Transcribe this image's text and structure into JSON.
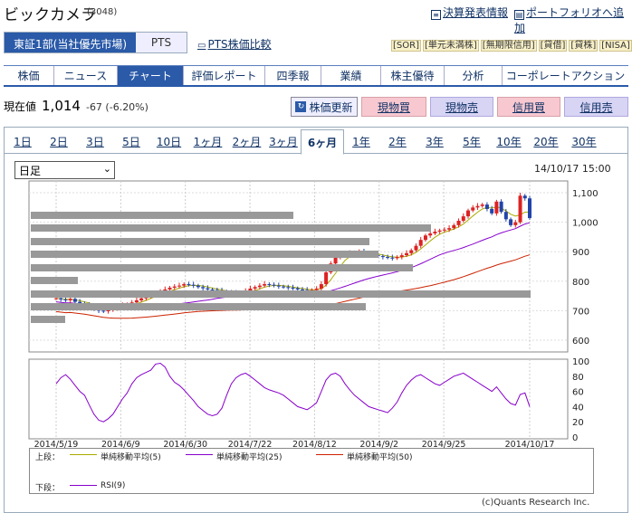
{
  "header": {
    "title": "ビックカメラ",
    "code": "(3048)",
    "links": [
      {
        "icon": "document-icon",
        "label": "決算発表情報"
      },
      {
        "icon": "portfolio-icon",
        "label": "ポートフォリオへ追加"
      }
    ]
  },
  "market_tabs": [
    {
      "label": "東証1部(当社優先市場)",
      "active": true
    },
    {
      "label": "PTS",
      "active": false
    }
  ],
  "pts_compare": "PTS株価比較",
  "tags": [
    "[SOR]",
    "[単元未満株]",
    "[無期限信用]",
    "[貸借]",
    "[貸株]",
    "[NISA]"
  ],
  "nav": {
    "items": [
      {
        "label": "株価"
      },
      {
        "label": "ニュース"
      },
      {
        "label": "チャート",
        "active": true
      },
      {
        "label": "評価レポート"
      },
      {
        "label": "四季報"
      },
      {
        "label": "業績"
      },
      {
        "label": "株主優待"
      },
      {
        "label": "分析"
      },
      {
        "label": "コーポレートアクション"
      }
    ]
  },
  "quote": {
    "label": "現在値",
    "price": "1,014",
    "change": "-67 (-6.20%)"
  },
  "buttons": {
    "refresh": "株価更新",
    "genbutsu_buy": "現物買",
    "genbutsu_sell": "現物売",
    "shinyo_buy": "信用買",
    "shinyo_sell": "信用売"
  },
  "periods": [
    "1日",
    "2日",
    "3日",
    "5日",
    "10日",
    "1ヶ月",
    "2ヶ月",
    "3ヶ月",
    "6ヶ月",
    "1年",
    "2年",
    "3年",
    "5年",
    "10年",
    "20年",
    "30年"
  ],
  "active_period": "6ヶ月",
  "interval": "日足",
  "datetime": "14/10/17 15:00",
  "chart_data": [
    {
      "type": "candlestick",
      "x_ticks": [
        "2014/5/19",
        "2014/6/9",
        "2014/6/30",
        "2014/7/22",
        "2014/8/12",
        "2014/9/2",
        "2014/9/25",
        "2014/10/17"
      ],
      "y_ticks": [
        600,
        700,
        800,
        900,
        "1,000",
        "1,100"
      ],
      "ylim": [
        560,
        1140
      ],
      "close": [
        742,
        738,
        735,
        740,
        730,
        725,
        720,
        715,
        705,
        700,
        698,
        702,
        708,
        712,
        718,
        722,
        728,
        735,
        742,
        748,
        755,
        760,
        765,
        772,
        778,
        782,
        785,
        790,
        788,
        785,
        780,
        776,
        772,
        770,
        768,
        765,
        762,
        760,
        758,
        762,
        768,
        775,
        780,
        785,
        790,
        788,
        785,
        782,
        780,
        778,
        776,
        772,
        770,
        768,
        770,
        775,
        790,
        830,
        860,
        880,
        890,
        892,
        895,
        898,
        900,
        896,
        892,
        888,
        885,
        882,
        880,
        878,
        882,
        888,
        895,
        905,
        920,
        940,
        955,
        962,
        968,
        972,
        975,
        980,
        990,
        1005,
        1020,
        1040,
        1050,
        1055,
        1060,
        1045,
        1030,
        1070,
        1035,
        1010,
        990,
        1000,
        1090,
        1081,
        1014
      ],
      "series": [
        {
          "name": "単純移動平均(5)",
          "color": "#aaaa00"
        },
        {
          "name": "単純移動平均(25)",
          "color": "#8800cc"
        },
        {
          "name": "単純移動平均(50)",
          "color": "#cc2200"
        }
      ]
    },
    {
      "type": "line",
      "series": [
        {
          "name": "RSI(9)",
          "color": "#8800cc"
        }
      ],
      "y_ticks": [
        0,
        20,
        40,
        60,
        80,
        100
      ],
      "ylim": [
        0,
        100
      ],
      "values": [
        70,
        78,
        82,
        76,
        68,
        60,
        55,
        42,
        30,
        22,
        20,
        24,
        30,
        40,
        50,
        58,
        70,
        78,
        82,
        85,
        88,
        96,
        97,
        92,
        80,
        72,
        68,
        62,
        55,
        48,
        40,
        35,
        30,
        28,
        30,
        38,
        55,
        70,
        78,
        82,
        84,
        80,
        75,
        70,
        65,
        62,
        60,
        58,
        55,
        50,
        45,
        40,
        38,
        36,
        40,
        45,
        60,
        75,
        82,
        84,
        80,
        70,
        62,
        55,
        50,
        45,
        40,
        38,
        36,
        34,
        32,
        38,
        46,
        58,
        68,
        75,
        80,
        82,
        78,
        74,
        70,
        68,
        72,
        76,
        80,
        82,
        84,
        80,
        76,
        72,
        68,
        64,
        60,
        66,
        58,
        50,
        44,
        42,
        56,
        58,
        40
      ]
    }
  ],
  "legend": {
    "upper_label": "上段：",
    "lower_label": "下段：",
    "upper": [
      "単純移動平均(5)",
      "単純移動平均(25)",
      "単純移動平均(50)"
    ],
    "lower": [
      "RSI(9)"
    ]
  },
  "credit": "(c)Quants Research Inc."
}
